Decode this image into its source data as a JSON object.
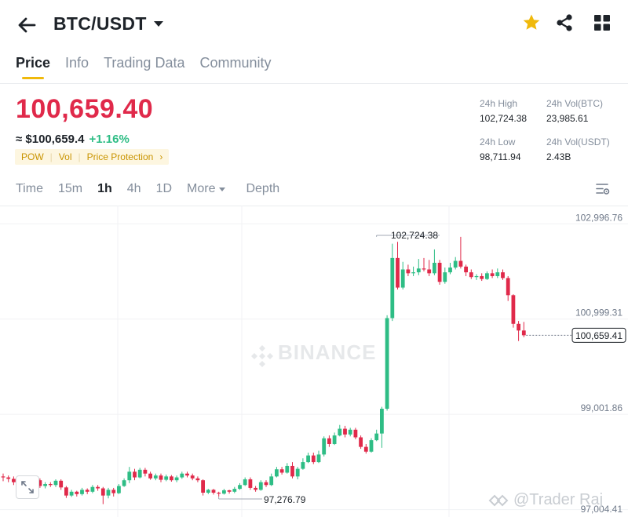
{
  "header": {
    "pair": "BTC/USDT",
    "icons": [
      "back-arrow-icon",
      "star-icon",
      "share-icon",
      "grid-icon"
    ],
    "star_color": "#f0b90b"
  },
  "tabs": [
    "Price",
    "Info",
    "Trading Data",
    "Community"
  ],
  "active_tab": "Price",
  "price": {
    "last": "100,659.40",
    "usd": "≈ $100,659.4",
    "change": "+1.16%",
    "tags": [
      "POW",
      "Vol",
      "Price Protection"
    ]
  },
  "stats": {
    "high_label": "24h High",
    "high_value": "102,724.38",
    "low_label": "24h Low",
    "low_value": "98,711.94",
    "vol_btc_label": "24h Vol(BTC)",
    "vol_btc_value": "23,985.61",
    "vol_usdt_label": "24h Vol(USDT)",
    "vol_usdt_value": "2.43B"
  },
  "timeframes": [
    "Time",
    "15m",
    "1h",
    "4h",
    "1D"
  ],
  "active_timeframe": "1h",
  "more_label": "More",
  "depth_label": "Depth",
  "watermark": "BINANCE",
  "credit": "@Trader Raj",
  "colors": {
    "up": "#2ebd85",
    "down": "#e0294a",
    "accent": "#f0b90b"
  },
  "chart_data": {
    "type": "candlestick",
    "y_ticks": [
      "102,996.76",
      "100,999.31",
      "99,001.86",
      "97,004.41"
    ],
    "ylim": [
      96850,
      103380
    ],
    "current_price": 100659.41,
    "current_price_label": "100,659.41",
    "max_annotation": {
      "value": 102724.38,
      "label": "102,724.38",
      "index": 71
    },
    "min_annotation": {
      "value": 97276.79,
      "label": "97,276.79",
      "index": 41
    },
    "candles": [
      [
        97700,
        97680,
        97760,
        97600
      ],
      [
        97680,
        97650,
        97720,
        97580
      ],
      [
        97650,
        97580,
        97700,
        97520
      ],
      [
        97580,
        97600,
        97660,
        97460
      ],
      [
        97600,
        97420,
        97640,
        97380
      ],
      [
        97420,
        97600,
        97680,
        97380
      ],
      [
        97600,
        97620,
        97690,
        97560
      ],
      [
        97620,
        97500,
        97660,
        97460
      ],
      [
        97500,
        97540,
        97580,
        97450
      ],
      [
        97540,
        97520,
        97580,
        97480
      ],
      [
        97520,
        97610,
        97640,
        97480
      ],
      [
        97610,
        97470,
        97640,
        97420
      ],
      [
        97470,
        97300,
        97500,
        97250
      ],
      [
        97300,
        97380,
        97420,
        97270
      ],
      [
        97380,
        97330,
        97400,
        97280
      ],
      [
        97330,
        97420,
        97460,
        97300
      ],
      [
        97420,
        97380,
        97450,
        97330
      ],
      [
        97380,
        97480,
        97520,
        97350
      ],
      [
        97480,
        97450,
        97520,
        97400
      ],
      [
        97450,
        97300,
        97480,
        97120
      ],
      [
        97300,
        97420,
        97460,
        97240
      ],
      [
        97420,
        97350,
        97460,
        97280
      ],
      [
        97350,
        97500,
        97540,
        97330
      ],
      [
        97500,
        97620,
        97660,
        97480
      ],
      [
        97620,
        97800,
        97900,
        97560
      ],
      [
        97800,
        97680,
        97860,
        97620
      ],
      [
        97680,
        97840,
        97880,
        97660
      ],
      [
        97840,
        97760,
        97880,
        97700
      ],
      [
        97760,
        97660,
        97800,
        97630
      ],
      [
        97660,
        97720,
        97760,
        97620
      ],
      [
        97720,
        97630,
        97760,
        97580
      ],
      [
        97630,
        97700,
        97740,
        97600
      ],
      [
        97700,
        97620,
        97730,
        97590
      ],
      [
        97620,
        97680,
        97720,
        97580
      ],
      [
        97680,
        97760,
        97800,
        97650
      ],
      [
        97760,
        97720,
        97800,
        97680
      ],
      [
        97720,
        97660,
        97760,
        97620
      ],
      [
        97660,
        97620,
        97700,
        97580
      ],
      [
        97620,
        97360,
        97640,
        97300
      ],
      [
        97360,
        97420,
        97440,
        97330
      ],
      [
        97420,
        97360,
        97440,
        97320
      ],
      [
        97360,
        97340,
        97380,
        97280
      ],
      [
        97340,
        97410,
        97440,
        97320
      ],
      [
        97410,
        97380,
        97420,
        97340
      ],
      [
        97380,
        97440,
        97480,
        97350
      ],
      [
        97440,
        97520,
        97560,
        97420
      ],
      [
        97520,
        97640,
        97680,
        97500
      ],
      [
        97640,
        97460,
        97680,
        97420
      ],
      [
        97460,
        97420,
        97500,
        97380
      ],
      [
        97420,
        97580,
        97620,
        97400
      ],
      [
        97580,
        97520,
        97620,
        97480
      ],
      [
        97520,
        97700,
        97760,
        97500
      ],
      [
        97700,
        97850,
        97900,
        97680
      ],
      [
        97850,
        97780,
        97900,
        97740
      ],
      [
        97780,
        97920,
        97980,
        97760
      ],
      [
        97920,
        97700,
        98000,
        97660
      ],
      [
        97700,
        97860,
        97900,
        97640
      ],
      [
        97860,
        98000,
        98080,
        97840
      ],
      [
        98000,
        98140,
        98200,
        97980
      ],
      [
        98140,
        98000,
        98200,
        97960
      ],
      [
        98000,
        98160,
        98240,
        97980
      ],
      [
        98160,
        98500,
        98540,
        98120
      ],
      [
        98500,
        98380,
        98560,
        98320
      ],
      [
        98380,
        98560,
        98620,
        98360
      ],
      [
        98560,
        98700,
        98780,
        98540
      ],
      [
        98700,
        98580,
        98760,
        98520
      ],
      [
        98580,
        98680,
        98720,
        98540
      ],
      [
        98680,
        98520,
        98720,
        98480
      ],
      [
        98520,
        98320,
        98560,
        98280
      ],
      [
        98320,
        98220,
        98380,
        98180
      ],
      [
        98220,
        98460,
        98500,
        98200
      ],
      [
        98460,
        98600,
        98680,
        98440
      ],
      [
        98600,
        99120,
        99160,
        98300
      ],
      [
        99120,
        101020,
        101080,
        99080
      ],
      [
        101020,
        102280,
        102580,
        100960
      ],
      [
        102280,
        101660,
        102620,
        101620
      ],
      [
        101660,
        102040,
        102200,
        101620
      ],
      [
        102040,
        101960,
        102140,
        101900
      ],
      [
        101960,
        101980,
        102100,
        101900
      ],
      [
        101980,
        102060,
        102260,
        101920
      ],
      [
        102060,
        102040,
        102280,
        102000
      ],
      [
        102040,
        101960,
        102240,
        101900
      ],
      [
        101960,
        102180,
        102460,
        101920
      ],
      [
        102180,
        101780,
        102240,
        101720
      ],
      [
        101780,
        101980,
        102080,
        101740
      ],
      [
        101980,
        102080,
        102180,
        101940
      ],
      [
        102080,
        102220,
        102300,
        102040
      ],
      [
        102220,
        102100,
        102724,
        102060
      ],
      [
        102100,
        101980,
        102140,
        101900
      ],
      [
        101980,
        101880,
        102040,
        101840
      ],
      [
        101880,
        101900,
        101940,
        101820
      ],
      [
        101900,
        101840,
        101960,
        101800
      ],
      [
        101840,
        101960,
        102000,
        101820
      ],
      [
        101960,
        101900,
        102040,
        101860
      ],
      [
        101900,
        101980,
        102060,
        101860
      ],
      [
        101980,
        101860,
        102040,
        101820
      ],
      [
        101860,
        101500,
        101900,
        101380
      ],
      [
        101500,
        100900,
        101520,
        100820
      ],
      [
        100900,
        100760,
        100960,
        100540
      ],
      [
        100760,
        100660,
        100940,
        100620
      ]
    ]
  }
}
